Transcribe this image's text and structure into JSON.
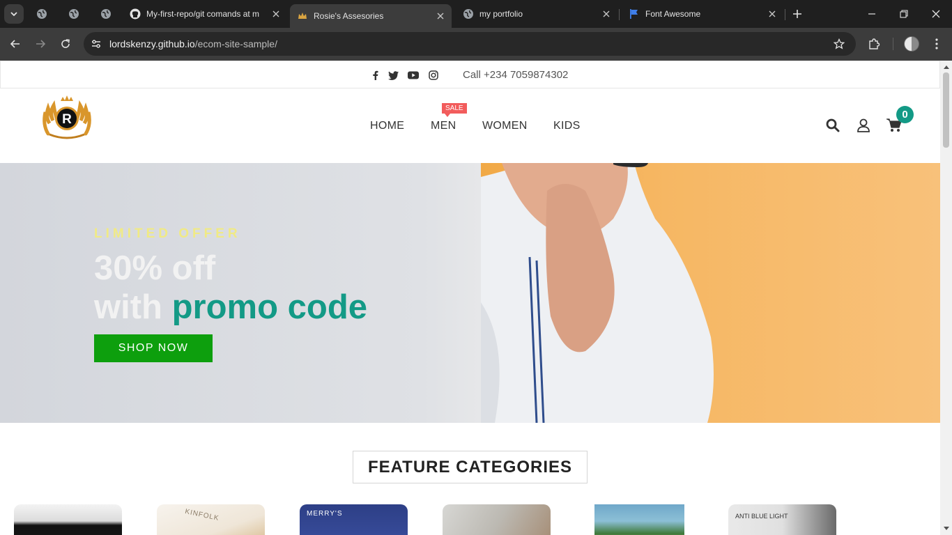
{
  "browser": {
    "tabs": [
      {
        "title": "My-first-repo/git comands at m",
        "icon": "github-icon"
      },
      {
        "title": "Rosie's Assesories",
        "icon": "crown-favicon",
        "active": true
      },
      {
        "title": "my portfolio",
        "icon": "globe-icon"
      },
      {
        "title": "Font Awesome",
        "icon": "flag-icon"
      }
    ],
    "url_host": "lordskenzy.github.io",
    "url_path": "/ecom-site-sample/"
  },
  "topbar": {
    "phone": "Call +234 7059874302",
    "social": [
      "facebook-icon",
      "twitter-icon",
      "youtube-icon",
      "instagram-icon"
    ]
  },
  "header": {
    "logo_letter": "R",
    "nav": [
      "HOME",
      "MEN",
      "WOMEN",
      "KIDS"
    ],
    "sale_badge": "SALE",
    "cart_count": "0"
  },
  "hero": {
    "eyebrow": "LIMITED OFFER",
    "line1": "30% off",
    "line2_prefix": "with ",
    "line2_accent": "promo code",
    "button": "SHOP NOW"
  },
  "features": {
    "title": "FEATURE CATEGORIES",
    "cards": [
      {
        "text": ""
      },
      {
        "text": "KINFOLK"
      },
      {
        "text": "MERRY'S"
      },
      {
        "text": ""
      },
      {
        "text": ""
      },
      {
        "text": "ANTI BLUE LIGHT"
      }
    ]
  },
  "colors": {
    "accent": "#139a86",
    "button": "#0d9f0d",
    "sale": "#f25c5c",
    "eyebrow": "#f0ea85"
  }
}
